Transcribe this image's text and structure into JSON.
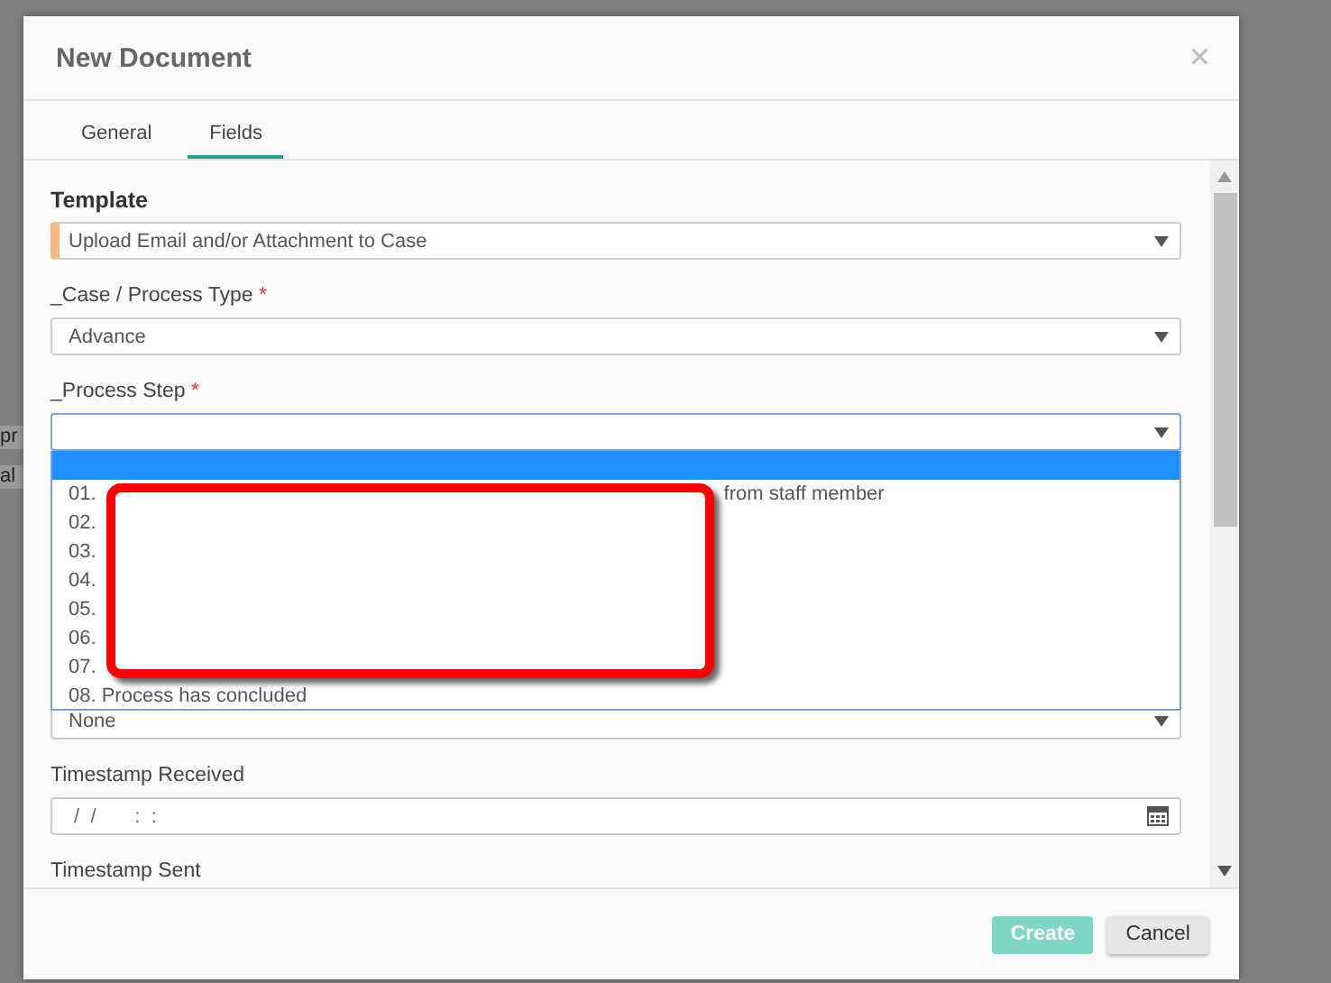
{
  "background": {
    "snippets": [
      "pr",
      "al"
    ]
  },
  "dialog": {
    "title": "New Document",
    "close": "×",
    "tabs": [
      {
        "label": "General",
        "selected": false
      },
      {
        "label": "Fields",
        "selected": true
      }
    ],
    "template": {
      "label": "Template",
      "value": "Upload Email and/or Attachment to Case"
    },
    "case_type": {
      "label": "_Case / Process Type",
      "required": "*",
      "value": "Advance"
    },
    "process_step": {
      "label": "_Process Step",
      "required": "*",
      "expanded": true,
      "options": [
        {
          "selected": true
        },
        {
          "label": "01.",
          "tail": "from staff member",
          "selected": false
        },
        {
          "label": "02.",
          "selected": false
        },
        {
          "label": "03.",
          "selected": false
        },
        {
          "label": "04.",
          "selected": false
        },
        {
          "label": "05.",
          "selected": false
        },
        {
          "label": "06.",
          "selected": false
        },
        {
          "label": "07.",
          "selected": false
        },
        {
          "label": "08. Process has concluded",
          "selected": false
        }
      ]
    },
    "hidden_select": {
      "value": "None"
    },
    "timestamp_received": {
      "label": "Timestamp Received",
      "value": " /  /       :  :"
    },
    "timestamp_sent": {
      "label": "Timestamp Sent"
    },
    "buttons": [
      {
        "label": "Create",
        "kind": "primary",
        "disabled": true
      },
      {
        "label": "Cancel",
        "kind": "secondary",
        "disabled": false
      }
    ]
  }
}
